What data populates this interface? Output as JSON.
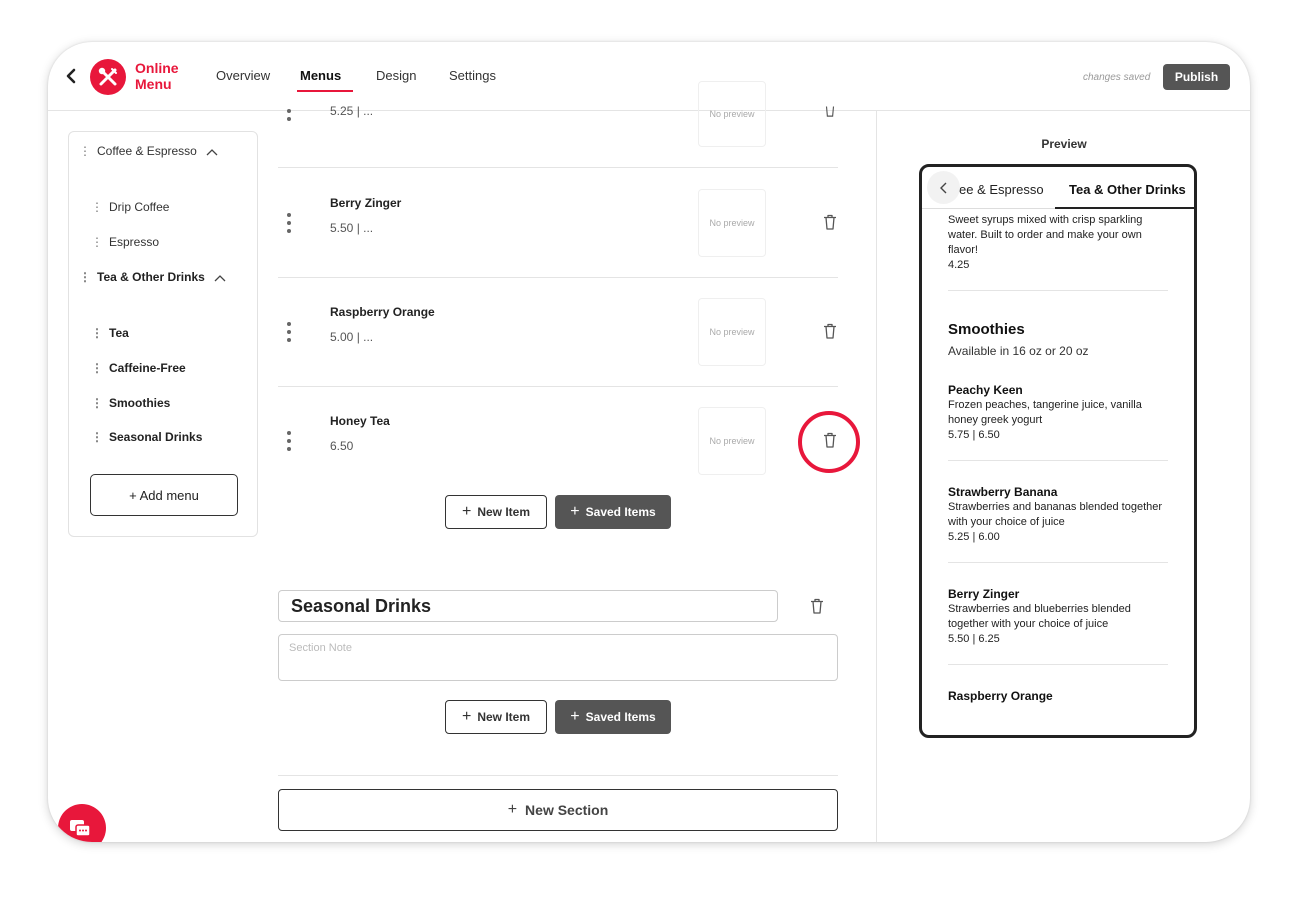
{
  "header": {
    "brand_line1": "Online",
    "brand_line2": "Menu",
    "tabs": [
      {
        "label": "Overview"
      },
      {
        "label": "Menus"
      },
      {
        "label": "Design"
      },
      {
        "label": "Settings"
      }
    ],
    "save_status": "changes saved",
    "publish_label": "Publish"
  },
  "sidebar": {
    "menus": [
      {
        "label": "Coffee & Espresso",
        "items": [
          "Drip Coffee",
          "Espresso"
        ]
      },
      {
        "label": "Tea & Other Drinks",
        "items": [
          "Tea",
          "Caffeine-Free",
          "Smoothies",
          "Seasonal Drinks"
        ]
      }
    ],
    "add_menu_label": "+ Add menu"
  },
  "editor": {
    "partial_item_price": "5.25 | ...",
    "items": [
      {
        "name": "Berry Zinger",
        "price": "5.50 | ..."
      },
      {
        "name": "Raspberry Orange",
        "price": "5.00 | ..."
      },
      {
        "name": "Honey Tea",
        "price": "6.50"
      }
    ],
    "no_preview": "No preview",
    "new_item_label": "New Item",
    "saved_items_label": "Saved Items",
    "section_title": "Seasonal Drinks",
    "section_note_placeholder": "Section Note",
    "new_section_label": "New Section"
  },
  "preview": {
    "label": "Preview",
    "tabs": [
      "ee & Espresso",
      "Tea & Other Drinks"
    ],
    "top_desc": "Sweet syrups mixed with crisp sparkling water. Built to order and make your own flavor!",
    "top_price": "4.25",
    "section_title": "Smoothies",
    "section_note": "Available in 16 oz or 20 oz",
    "items": [
      {
        "name": "Peachy Keen",
        "desc": "Frozen peaches, tangerine juice, vanilla honey greek yogurt",
        "price": "5.75 | 6.50"
      },
      {
        "name": "Strawberry Banana",
        "desc": "Strawberries and bananas blended together with your choice of juice",
        "price": "5.25 | 6.00"
      },
      {
        "name": "Berry Zinger",
        "desc": "Strawberries and blueberries blended together with your choice of juice",
        "price": "5.50 | 6.25"
      },
      {
        "name": "Raspberry Orange"
      }
    ]
  },
  "colors": {
    "brand": "#e8173b",
    "dark_button": "#555555"
  },
  "icons": [
    "back-chevron-icon",
    "utensils-logo-icon",
    "chevron-up-icon",
    "drag-handle-icon",
    "kebab-drag-icon",
    "trash-icon",
    "plus-icon",
    "chat-icon"
  ]
}
